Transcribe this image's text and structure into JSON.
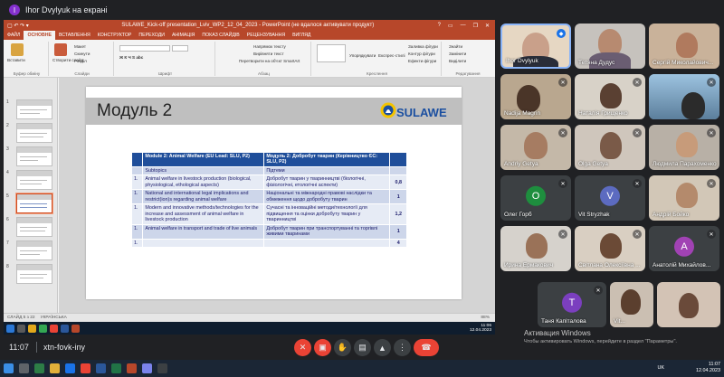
{
  "presenter": {
    "initial": "I",
    "label": "Ihor Dvylyuk на екрані"
  },
  "ppt": {
    "title": "SULAWE_Kick-off presentation_Lviv_WP2_12_04_2023 - PowerPoint (не вдалося активувати продукт)",
    "quick_access": "▢ ↶ ↷ ▾",
    "window_buttons": [
      "?",
      "▭",
      "—",
      "❐",
      "✕"
    ],
    "tabs": [
      "ФАЙЛ",
      "ОСНОВНЕ",
      "ВСТАВЛЕННЯ",
      "КОНСТРУКТОР",
      "ПЕРЕХОДИ",
      "АНІМАЦІЯ",
      "ПОКАЗ СЛАЙДІВ",
      "РЕЦЕНЗУВАННЯ",
      "ВИГЛЯД"
    ],
    "active_tab": "ОСНОВНЕ",
    "ribbon": {
      "paste": "Вставити",
      "clipboard": "Буфер обміну",
      "new_slide": "Створити слайд",
      "layout": "Макет",
      "reset": "Скинути",
      "section": "Розділ",
      "slides": "Слайди",
      "font": "Шрифт",
      "paragraph": "Абзац",
      "text_direction": "Напрямок тексту",
      "align_text": "Вирівняти текст",
      "convert_smartart": "Перетворити на об'єкт SmartArt",
      "drawing": "Креслення",
      "arrange": "Упорядкувати",
      "quick_styles": "Експрес-стилі",
      "shape_fill": "Заливка фігури",
      "shape_outline": "Контур фігури",
      "shape_effects": "Ефекти фігури",
      "find": "Знайти",
      "replace": "Замінити",
      "select": "Виділити",
      "editing": "Редагування"
    },
    "thumb_numbers": [
      "1",
      "2",
      "3",
      "4",
      "5",
      "6",
      "7",
      "8"
    ],
    "status_slide": "СЛАЙД 5 з 22",
    "status_lang": "УКРАЇНСЬКА",
    "status_zoom": "88%"
  },
  "slide": {
    "title": "Модуль 2",
    "logo": "SULAWE",
    "table": {
      "header": [
        "",
        "Module 2: Animal Welfare (EU Lead: SLU, P2)",
        "Модуль 2: Добробут тварин (Керівництво ЄС: SLU, P2)",
        ""
      ],
      "rows": [
        [
          "",
          "Subtopics",
          "Підтеми",
          ""
        ],
        [
          "1.",
          "Animal welfare in livestock production (biological, physiological, ethological aspects)",
          "Добробут тварин у тваринництві (біологічні, фізіологічні, етологічні аспекти)",
          "0,8"
        ],
        [
          "1.",
          "National and international legal implications and restrict(ion)s regarding animal welfare",
          "Національні та міжнародні правові наслідки та обмеження щодо добробуту тварин",
          "1"
        ],
        [
          "1.",
          "Modern and innovative methods/technologies for the increase and assessment of animal welfare in livestock production",
          "Сучасні та інноваційні методи/технології для підвищення та оцінки добробуту тварин у тваринництві",
          "1,2"
        ],
        [
          "1.",
          "Animal welfare in transport and trade of live animals",
          "Добробут тварин при транспортуванні та торгівлі живими тваринами",
          "1"
        ],
        [
          "1.",
          "",
          "",
          "4"
        ]
      ]
    }
  },
  "win_inner_taskbar": {
    "time": "11:06",
    "date": "12.04.2023"
  },
  "participants": [
    {
      "name": "Ihor Dvylyuk"
    },
    {
      "name": "Тетяна Дудус"
    },
    {
      "name": "Сергій Миколайович..."
    },
    {
      "name": "Nadija Magrin"
    },
    {
      "name": "Наталія Грищенко"
    },
    {
      "name": ""
    },
    {
      "name": "Andriy Getya"
    },
    {
      "name": "Olga Getya"
    },
    {
      "name": "Людмила Парахоменко"
    },
    {
      "name": "Олег Горб",
      "initial": "О"
    },
    {
      "name": "Vit Stryzhak",
      "initial": "V"
    },
    {
      "name": "Андрій Бойко"
    },
    {
      "name": "Ирина Ермакович"
    },
    {
      "name": "Світлана Олексіївна ..."
    },
    {
      "name": "Анатолій Михайлов...",
      "initial": "А"
    },
    {
      "name": "Таня Капіталова",
      "initial": "Т"
    },
    {
      "name": "Vit..."
    },
    {
      "name": ""
    }
  ],
  "meet": {
    "time": "11:07",
    "code": "xtn-fovk-iny"
  },
  "activation": {
    "title": "Активация Windows",
    "subtitle": "Чтобы активировать Windows, перейдите в раздел \"Параметры\"."
  },
  "system": {
    "lang": "UK",
    "time": "11:07",
    "date": "12.04.2023"
  },
  "colors": {
    "ppt_accent": "#b7472a",
    "meet_bg": "#202124",
    "end_call": "#ea4335",
    "table_header": "#1f4e9a"
  }
}
